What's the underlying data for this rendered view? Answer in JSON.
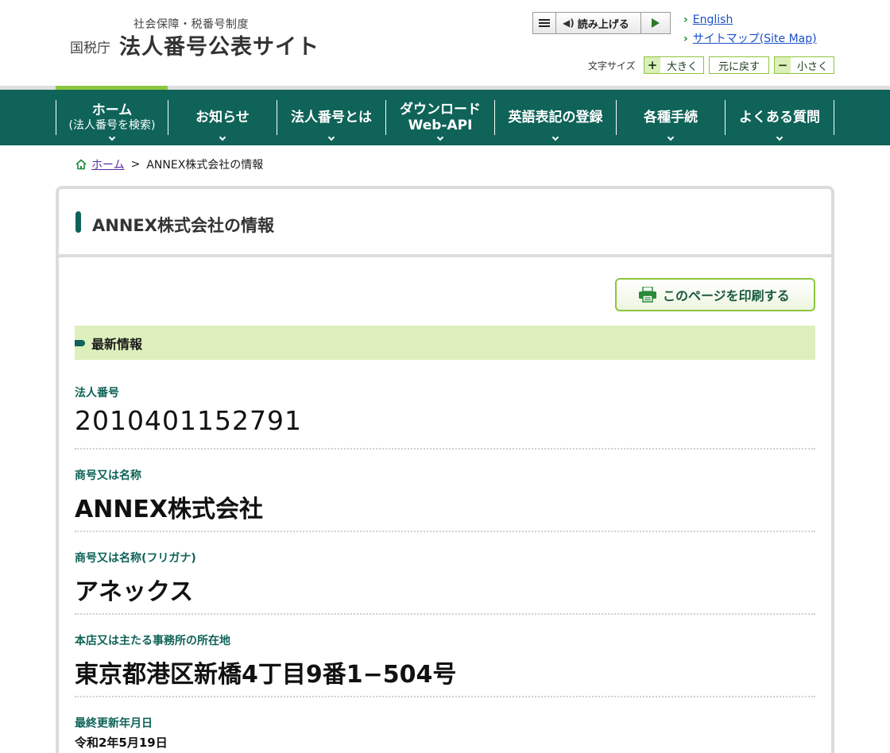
{
  "header": {
    "logo_sub": "社会保障・税番号制度",
    "logo_org": "国税庁",
    "logo_main": "法人番号公表サイト",
    "readbar_label": "読み上げる",
    "english_link": "English",
    "sitemap_link": "サイトマップ(Site Map)",
    "fontsize_label": "文字サイズ",
    "fontsize_larger": "大きく",
    "fontsize_reset": "元に戻す",
    "fontsize_smaller": "小さく"
  },
  "nav": {
    "items": [
      {
        "line1": "ホーム",
        "line2": "(法人番号を検索)"
      },
      {
        "line1": "お知らせ"
      },
      {
        "line1": "法人番号とは"
      },
      {
        "line1": "ダウンロード",
        "line2": "Web-API"
      },
      {
        "line1": "英語表記の登録"
      },
      {
        "line1": "各種手続"
      },
      {
        "line1": "よくある質問"
      }
    ]
  },
  "breadcrumb": {
    "home": "ホーム",
    "separator": ">",
    "current": "ANNEX株式会社の情報"
  },
  "panel": {
    "title": "ANNEX株式会社の情報",
    "print_label": "このページを印刷する",
    "section_title": "最新情報",
    "fields": [
      {
        "label": "法人番号",
        "value": "2010401152791"
      },
      {
        "label": "商号又は名称",
        "value": "ANNEX株式会社"
      },
      {
        "label": "商号又は名称(フリガナ)",
        "value": "アネックス"
      },
      {
        "label": "本店又は主たる事務所の所在地",
        "value": "東京都港区新橋4丁目9番1−504号"
      },
      {
        "label": "最終更新年月日",
        "value": "令和2年5月19日"
      }
    ]
  },
  "colors": {
    "brand_green": "#0f6358",
    "accent_lime": "#8cc63e",
    "section_bg": "#ddf0bc",
    "link_blue": "#1a4fc8"
  }
}
